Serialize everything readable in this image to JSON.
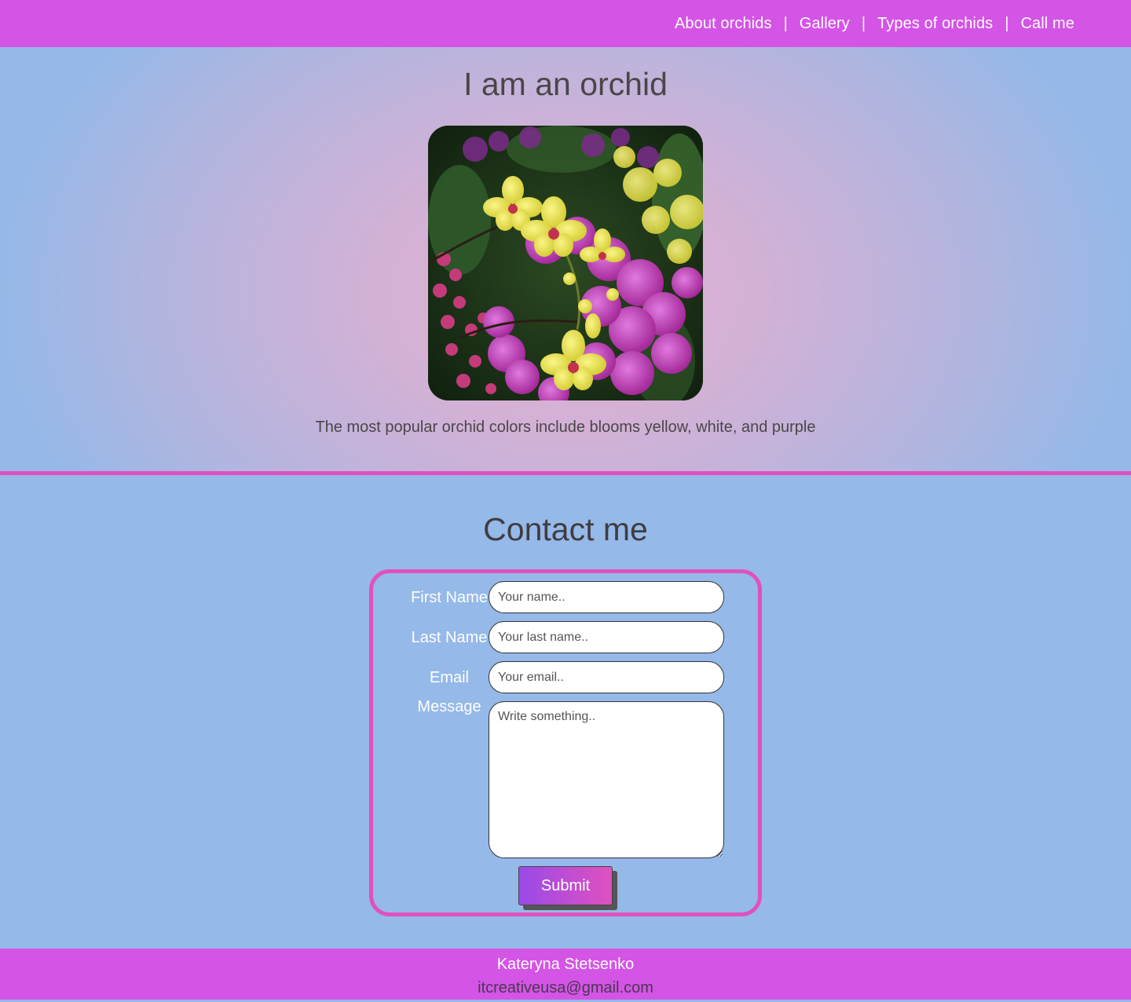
{
  "nav": {
    "items": [
      "About orchids",
      "Gallery",
      "Types of orchids",
      "Call me"
    ],
    "separator": "|"
  },
  "hero": {
    "title": "I am an orchid",
    "caption": "The most popular orchid colors include blooms yellow, white, and purple"
  },
  "contact": {
    "title": "Contact me",
    "fields": {
      "first_name": {
        "label": "First Name",
        "placeholder": "Your name.."
      },
      "last_name": {
        "label": "Last Name",
        "placeholder": "Your last name.."
      },
      "email": {
        "label": "Email",
        "placeholder": "Your email.."
      },
      "message": {
        "label": "Message",
        "placeholder": "Write something.."
      }
    },
    "submit_label": "Submit"
  },
  "footer": {
    "name": "Kateryna Stetsenko",
    "email": "itcreativeusa@gmail.com"
  },
  "colors": {
    "header_bg": "#d454e6",
    "page_bg": "#95b9e8",
    "accent_border": "#e050c0"
  }
}
